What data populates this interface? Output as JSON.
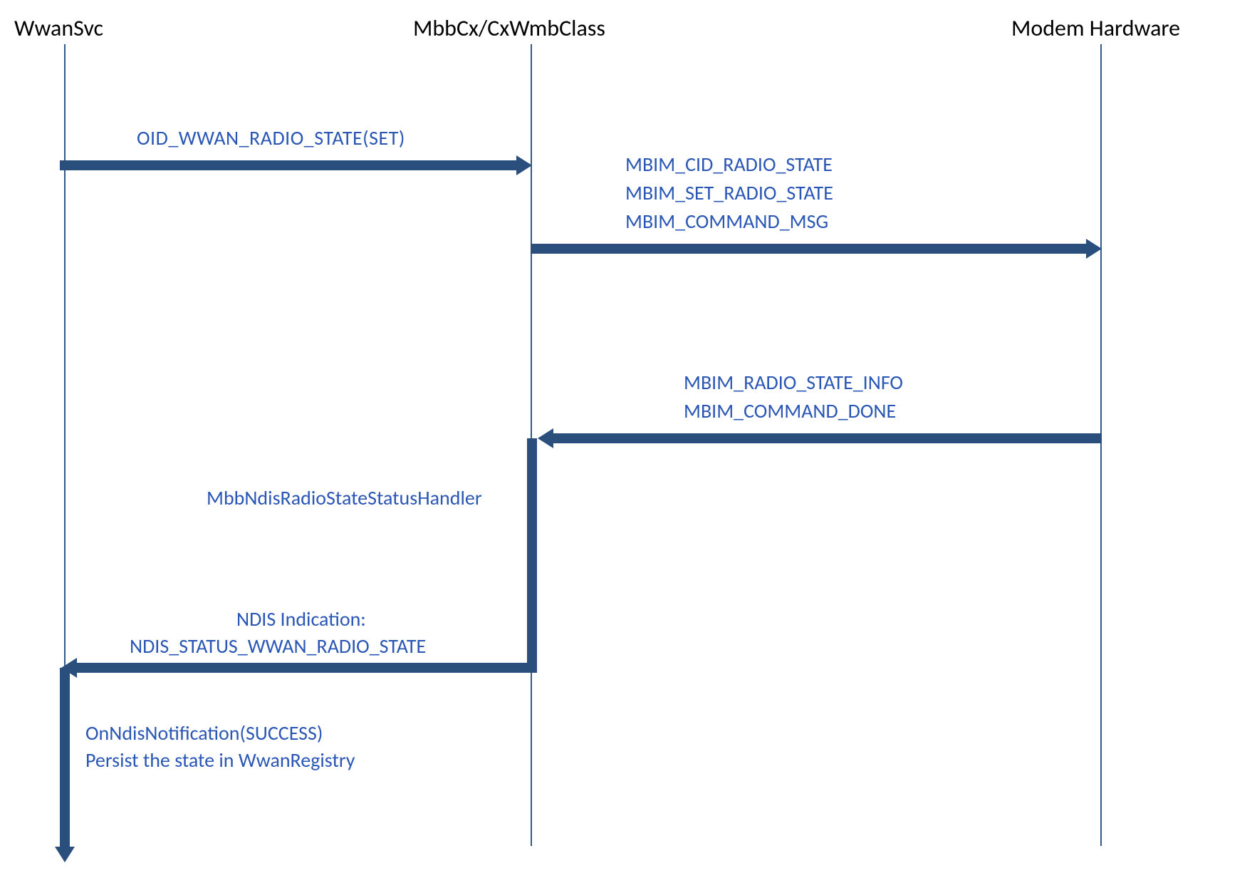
{
  "participants": {
    "wwansvc": "WwanSvc",
    "mbbcx": "MbbCx/CxWmbClass",
    "modem": "Modem Hardware"
  },
  "messages": {
    "oid_set": "OID_WWAN_RADIO_STATE(SET)",
    "mbim_cid": "MBIM_CID_RADIO_STATE",
    "mbim_set": "MBIM_SET_RADIO_STATE",
    "mbim_cmd": "MBIM_COMMAND_MSG",
    "mbim_info": "MBIM_RADIO_STATE_INFO",
    "mbim_done": "MBIM_COMMAND_DONE",
    "handler": "MbbNdisRadioStateStatusHandler",
    "ndis_ind1": "NDIS Indication:",
    "ndis_ind2": "NDIS_STATUS_WWAN_RADIO_STATE",
    "onndis": "OnNdisNotification(SUCCESS)",
    "persist": "Persist the state in WwanRegistry"
  },
  "colors": {
    "text_black": "#000000",
    "text_blue": "#2a56b5",
    "line_blue": "#305a8c",
    "arrow_fill": "#2a4f7d"
  }
}
